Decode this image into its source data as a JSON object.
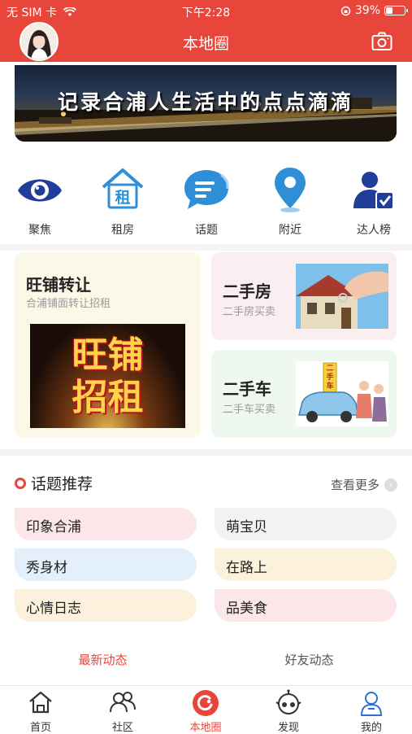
{
  "status": {
    "carrier": "无 SIM 卡",
    "time": "下午2:28",
    "battery": "39%",
    "battery_level": 0.39
  },
  "nav": {
    "title": "本地圈"
  },
  "banner": {
    "text": "记录合浦人生活中的点点滴滴"
  },
  "quick_icons": [
    {
      "label": "聚焦",
      "icon": "eye-icon"
    },
    {
      "label": "租房",
      "icon": "house-rent-icon"
    },
    {
      "label": "话题",
      "icon": "chat-bubble-icon"
    },
    {
      "label": "附近",
      "icon": "location-pin-icon"
    },
    {
      "label": "达人榜",
      "icon": "user-rank-icon"
    }
  ],
  "cards": {
    "shop": {
      "title": "旺铺转让",
      "subtitle": "合浦铺面转让招租",
      "image_text_1": "旺铺",
      "image_text_2": "招租"
    },
    "house": {
      "title": "二手房",
      "subtitle": "二手房买卖"
    },
    "car": {
      "title": "二手车",
      "subtitle": "二手车买卖",
      "sign_text": "二手车"
    }
  },
  "topics": {
    "header": "话题推荐",
    "more": "查看更多",
    "items": [
      "印象合浦",
      "萌宝贝",
      "秀身材",
      "在路上",
      "心情日志",
      "品美食"
    ]
  },
  "feed_tabs": [
    "最新动态",
    "好友动态"
  ],
  "bottom_tabs": [
    "首页",
    "社区",
    "本地圈",
    "发现",
    "我的"
  ],
  "colors": {
    "accent": "#e8453b",
    "icon_blue": "#1f3d99",
    "icon_sky": "#2f8fd6"
  }
}
